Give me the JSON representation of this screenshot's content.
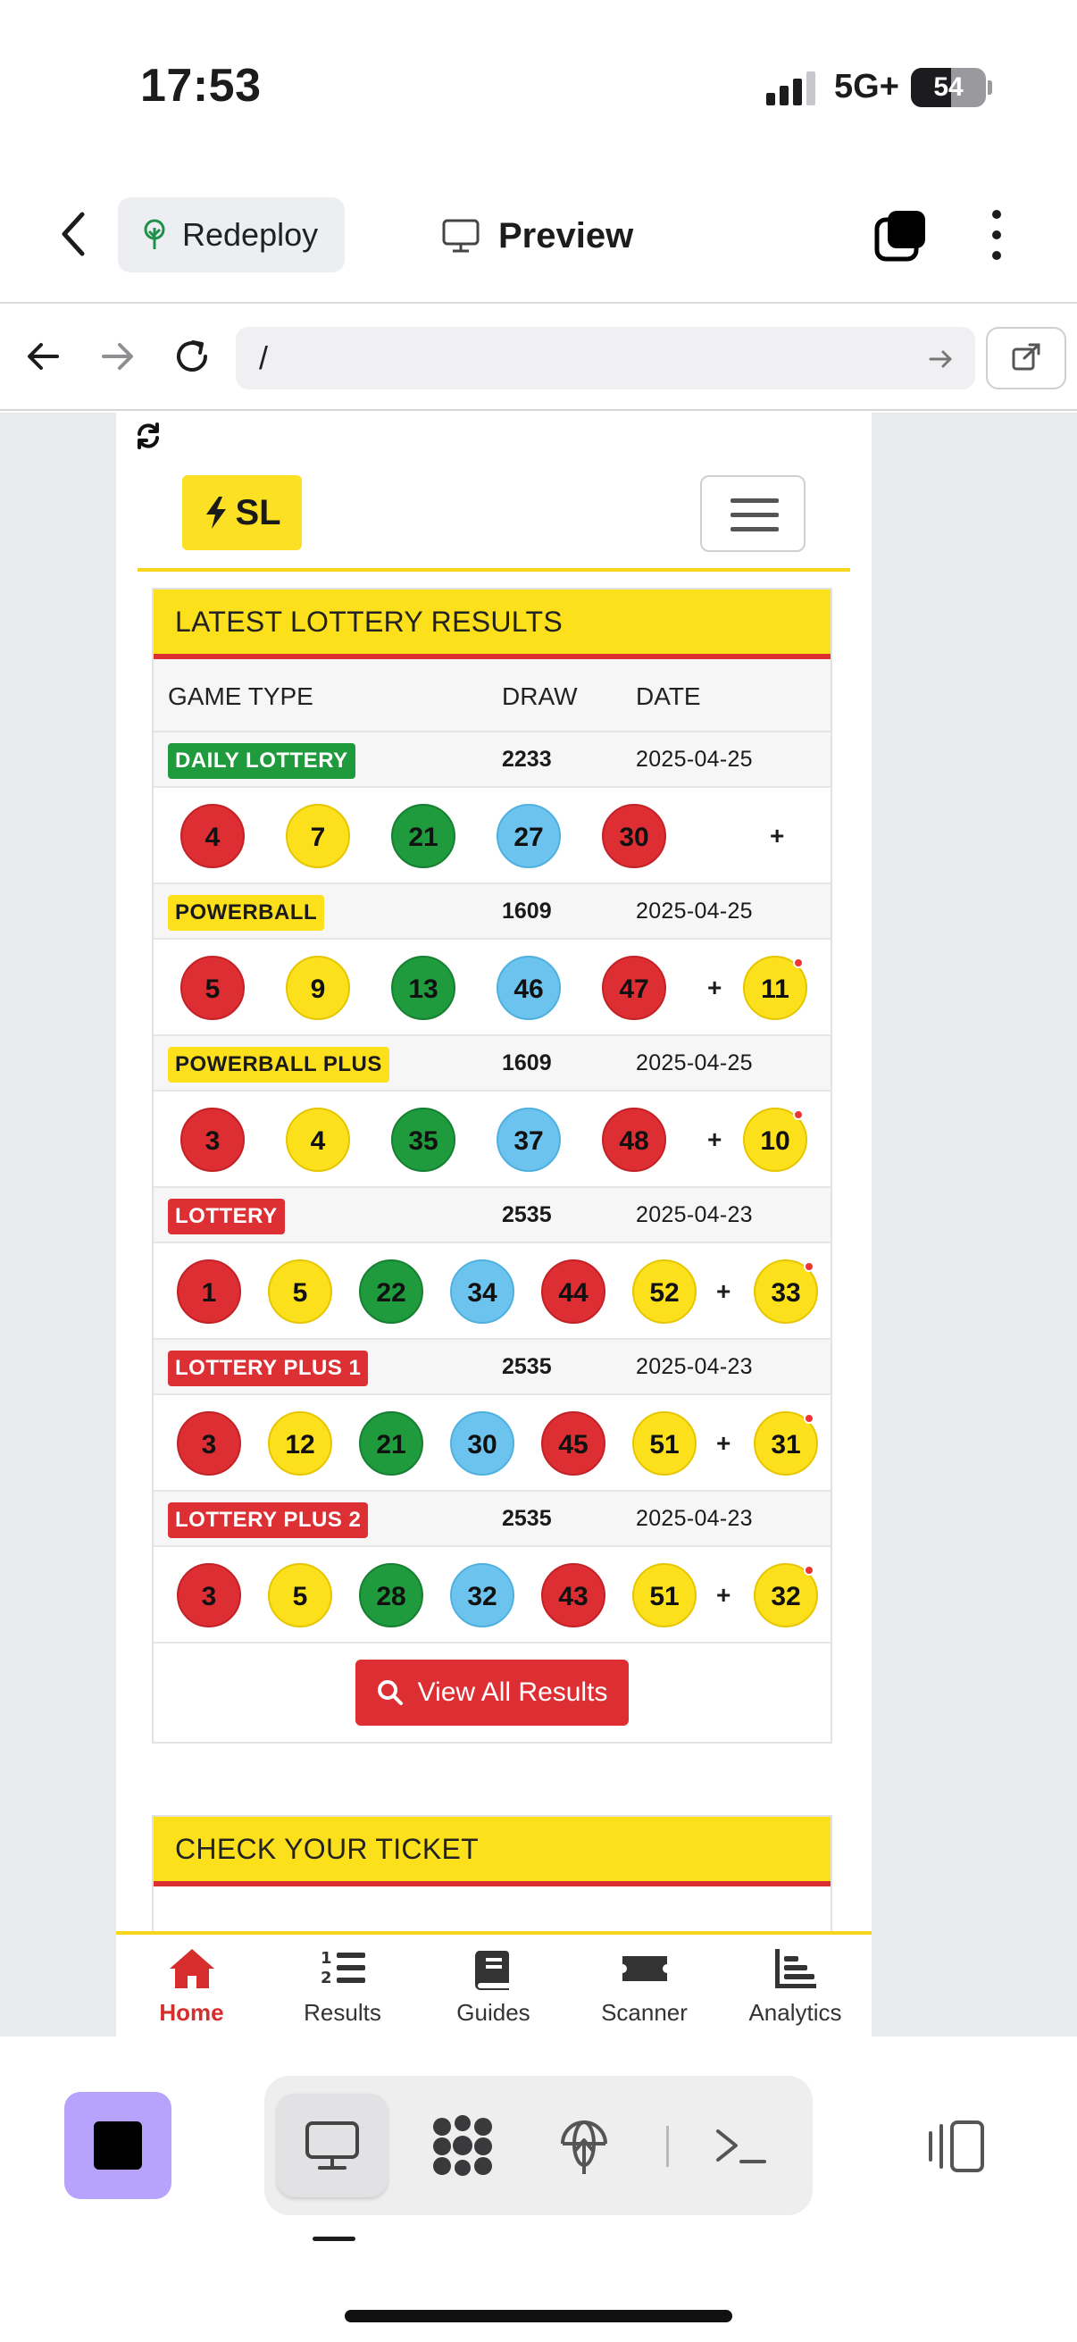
{
  "status_bar": {
    "time": "17:53",
    "network": "5G+",
    "battery": "54",
    "battery_level": 0.54
  },
  "app_header": {
    "redeploy_label": "Redeploy",
    "preview_label": "Preview"
  },
  "url_bar": {
    "url": "/"
  },
  "site": {
    "logo_text": "SL",
    "results_card": {
      "title": "LATEST LOTTERY RESULTS",
      "columns": [
        "GAME TYPE",
        "DRAW",
        "DATE"
      ],
      "rows": [
        {
          "game": "DAILY LOTTERY",
          "color": "green",
          "draw": "2233",
          "date": "2025-04-25",
          "balls": [
            {
              "n": "4",
              "c": "red"
            },
            {
              "n": "7",
              "c": "yellow"
            },
            {
              "n": "21",
              "c": "green"
            },
            {
              "n": "27",
              "c": "blue"
            },
            {
              "n": "30",
              "c": "red"
            }
          ],
          "plus": "+",
          "bonus": ""
        },
        {
          "game": "POWERBALL",
          "color": "yellow",
          "draw": "1609",
          "date": "2025-04-25",
          "balls": [
            {
              "n": "5",
              "c": "red"
            },
            {
              "n": "9",
              "c": "yellow"
            },
            {
              "n": "13",
              "c": "green"
            },
            {
              "n": "46",
              "c": "blue"
            },
            {
              "n": "47",
              "c": "red"
            }
          ],
          "plus": "+",
          "bonus": "11"
        },
        {
          "game": "POWERBALL PLUS",
          "color": "yellow",
          "draw": "1609",
          "date": "2025-04-25",
          "balls": [
            {
              "n": "3",
              "c": "red"
            },
            {
              "n": "4",
              "c": "yellow"
            },
            {
              "n": "35",
              "c": "green"
            },
            {
              "n": "37",
              "c": "blue"
            },
            {
              "n": "48",
              "c": "red"
            }
          ],
          "plus": "+",
          "bonus": "10"
        },
        {
          "game": "LOTTERY",
          "color": "red",
          "draw": "2535",
          "date": "2025-04-23",
          "balls": [
            {
              "n": "1",
              "c": "red"
            },
            {
              "n": "5",
              "c": "yellow"
            },
            {
              "n": "22",
              "c": "green"
            },
            {
              "n": "34",
              "c": "blue"
            },
            {
              "n": "44",
              "c": "red"
            },
            {
              "n": "52",
              "c": "yellow"
            }
          ],
          "plus": "+",
          "bonus": "33"
        },
        {
          "game": "LOTTERY PLUS 1",
          "color": "red",
          "draw": "2535",
          "date": "2025-04-23",
          "balls": [
            {
              "n": "3",
              "c": "red"
            },
            {
              "n": "12",
              "c": "yellow"
            },
            {
              "n": "21",
              "c": "green"
            },
            {
              "n": "30",
              "c": "blue"
            },
            {
              "n": "45",
              "c": "red"
            },
            {
              "n": "51",
              "c": "yellow"
            }
          ],
          "plus": "+",
          "bonus": "31"
        },
        {
          "game": "LOTTERY PLUS 2",
          "color": "red",
          "draw": "2535",
          "date": "2025-04-23",
          "balls": [
            {
              "n": "3",
              "c": "red"
            },
            {
              "n": "5",
              "c": "yellow"
            },
            {
              "n": "28",
              "c": "green"
            },
            {
              "n": "32",
              "c": "blue"
            },
            {
              "n": "43",
              "c": "red"
            },
            {
              "n": "51",
              "c": "yellow"
            }
          ],
          "plus": "+",
          "bonus": "32"
        }
      ],
      "button_label": "View All Results"
    },
    "ticket_card": {
      "title": "CHECK YOUR TICKET"
    },
    "tabbar": [
      "Home",
      "Results",
      "Guides",
      "Scanner",
      "Analytics"
    ]
  },
  "colors": {
    "accent_yellow": "#fde01c",
    "accent_red": "#dc2f2f",
    "stop_purple": "#b7a3fb"
  }
}
